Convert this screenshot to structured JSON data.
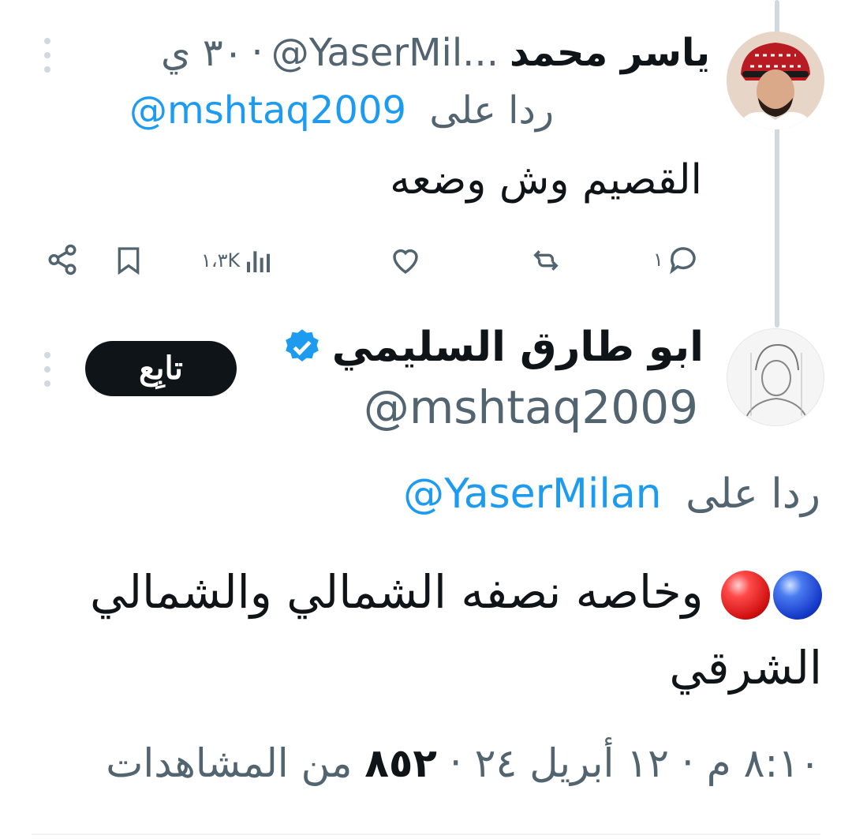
{
  "reply_tweet": {
    "author_name": "ياسر محمد",
    "author_handle": "@YaserMil...",
    "timestamp": "٣٠ ي",
    "replying_to_prefix": "ردا على",
    "replying_to_handle": "@mshtaq2009",
    "text": "القصيم وش وضعه",
    "actions": {
      "reply_count": "١",
      "views_count": "١،٣K"
    }
  },
  "main_tweet": {
    "author_name": "ابو طارق السليمي",
    "verified": true,
    "author_handle": "@mshtaq2009",
    "follow_label": "تابِع",
    "replying_to_prefix": "ردا على",
    "replying_to_handle": "@YaserMilan",
    "text": "وخاصه نصفه الشمالي والشمالي الشرقي",
    "time": "٨:١٠ م",
    "date": "١٢ أبريل ٢٤",
    "views_count": "٨٥٢",
    "views_label": "من المشاهدات"
  },
  "colors": {
    "accent": "#1d9bf0",
    "muted": "#536471",
    "text": "#0f1419"
  },
  "icons": [
    "share-icon",
    "bookmark-icon",
    "views-icon",
    "like-icon",
    "retweet-icon",
    "reply-icon",
    "verified-badge-icon",
    "more-icon"
  ]
}
